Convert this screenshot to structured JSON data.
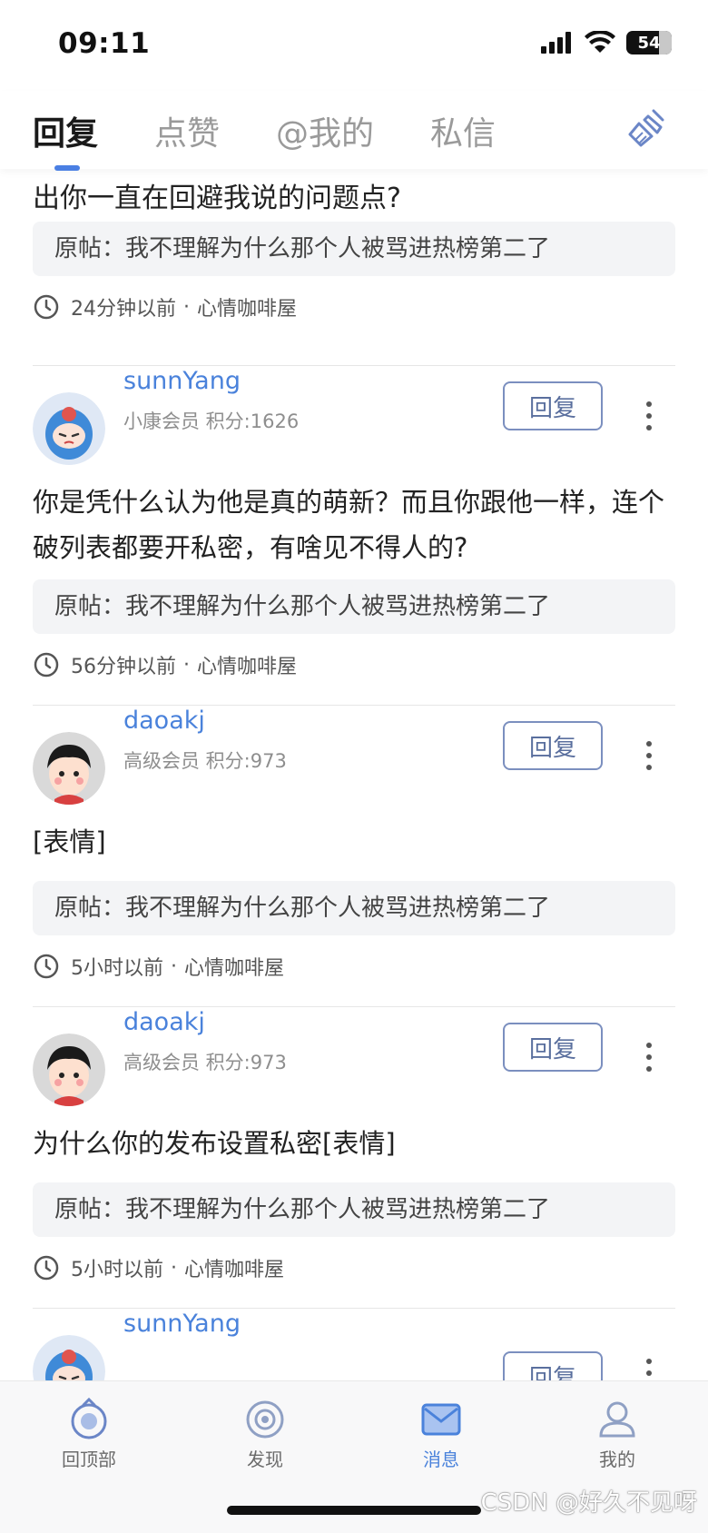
{
  "status": {
    "time": "09:11",
    "battery": "54"
  },
  "tabs": [
    {
      "label": "回复",
      "active": true
    },
    {
      "label": "点赞",
      "active": false
    },
    {
      "label": "@我的",
      "active": false
    },
    {
      "label": "私信",
      "active": false
    }
  ],
  "partial_item": {
    "content": "有话，而你一直在说你，当我是三岁小孩，当我看不出你一直在回避我说的问题点?",
    "quote": "原帖：我不理解为什么那个人被骂进热榜第二了",
    "time": "24分钟以前",
    "forum": "心情咖啡屋"
  },
  "items": [
    {
      "username": "sunnYang",
      "level": "小康会员 积分:1626",
      "reply_label": "回复",
      "content": "你是凭什么认为他是真的萌新？而且你跟他一样，连个破列表都要开私密，有啥见不得人的?",
      "quote": "原帖：我不理解为什么那个人被骂进热榜第二了",
      "time": "56分钟以前",
      "forum": "心情咖啡屋"
    },
    {
      "username": "daoakj",
      "level": "高级会员 积分:973",
      "reply_label": "回复",
      "content": "[表情]",
      "quote": "原帖：我不理解为什么那个人被骂进热榜第二了",
      "time": "5小时以前",
      "forum": "心情咖啡屋"
    },
    {
      "username": "daoakj",
      "level": "高级会员 积分:973",
      "reply_label": "回复",
      "content": "为什么你的发布设置私密[表情]",
      "quote": "原帖：我不理解为什么那个人被骂进热榜第二了",
      "time": "5小时以前",
      "forum": "心情咖啡屋"
    },
    {
      "username": "sunnYang",
      "reply_label": "回复"
    }
  ],
  "meta_separator": "·",
  "bottom_nav": [
    {
      "label": "回顶部",
      "icon": "back-to-top-icon",
      "active": false
    },
    {
      "label": "发现",
      "icon": "discover-icon",
      "active": false
    },
    {
      "label": "消息",
      "icon": "message-icon",
      "active": true
    },
    {
      "label": "我的",
      "icon": "profile-icon",
      "active": false
    }
  ],
  "watermark": "CSDN @好久不见呀",
  "colors": {
    "accent": "#4a82db",
    "username": "#4a82db",
    "quote_bg": "#f3f4f6"
  }
}
